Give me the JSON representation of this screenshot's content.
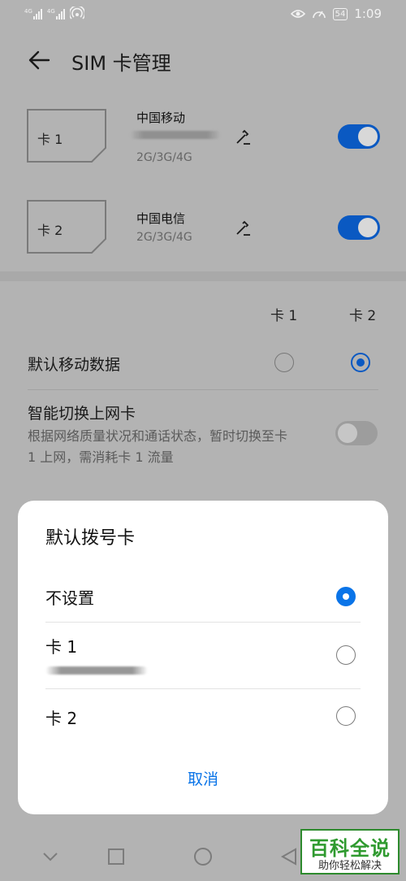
{
  "status_bar": {
    "network_left": "4G",
    "network_right": "4G",
    "battery": "54",
    "time": "1:09"
  },
  "header": {
    "title": "SIM 卡管理"
  },
  "sim_cards": [
    {
      "label": "卡 1",
      "carrier": "中国移动",
      "network": "2G/3G/4G",
      "enabled": true
    },
    {
      "label": "卡 2",
      "carrier": "中国电信",
      "network": "2G/3G/4G",
      "enabled": true
    }
  ],
  "settings": {
    "col_card1": "卡 1",
    "col_card2": "卡 2",
    "default_data": {
      "label": "默认移动数据",
      "selected": "卡 2"
    },
    "smart_switch": {
      "label": "智能切换上网卡",
      "description": "根据网络质量状况和通话状态，暂时切换至卡 1 上网，需消耗卡 1 流量",
      "enabled": false
    }
  },
  "dialog": {
    "title": "默认拨号卡",
    "options": [
      {
        "label": "不设置",
        "selected": true
      },
      {
        "label": "卡 1",
        "selected": false
      },
      {
        "label": "卡 2",
        "selected": false
      }
    ],
    "cancel_label": "取消"
  },
  "watermark": {
    "title": "百科全说",
    "subtitle": "助你轻松解决"
  },
  "colors": {
    "accent": "#0a74e8",
    "toggle_on": "#0a59c2",
    "dim_background": "#b3b3b3"
  }
}
